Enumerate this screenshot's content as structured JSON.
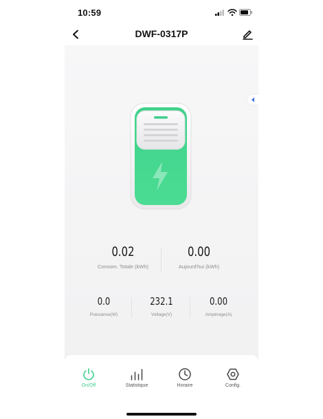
{
  "status_bar": {
    "time": "10:59",
    "icons": [
      "signal-icon",
      "wifi-icon",
      "battery-icon"
    ]
  },
  "header": {
    "title": "DWF-0317P",
    "back_icon": "chevron-left-icon",
    "edit_icon": "pencil-icon"
  },
  "device": {
    "state": "on",
    "icon": "lightning-bolt-icon"
  },
  "stats_primary": [
    {
      "value": "0.02",
      "label": "Consom. Totale (kWh)"
    },
    {
      "value": "0.00",
      "label": "Aujourd'hui (kWh)"
    }
  ],
  "stats_secondary": [
    {
      "value": "0.0",
      "label": "Puissance(W)"
    },
    {
      "value": "232.1",
      "label": "Voltage(V)"
    },
    {
      "value": "0.00",
      "label": "Ampérage(A)"
    }
  ],
  "tabs": [
    {
      "label": "On/Off",
      "icon": "power-icon",
      "active": true
    },
    {
      "label": "Statistique",
      "icon": "bar-chart-icon",
      "active": false
    },
    {
      "label": "Horaire",
      "icon": "clock-icon",
      "active": false
    },
    {
      "label": "Config.",
      "icon": "hexagon-settings-icon",
      "active": false
    }
  ],
  "colors": {
    "accent": "#3ecf8e",
    "device_green": "#45d88f",
    "text_primary": "#1a1a1a",
    "text_secondary": "#8c8c8c",
    "handle_blue": "#3f6ee8"
  }
}
